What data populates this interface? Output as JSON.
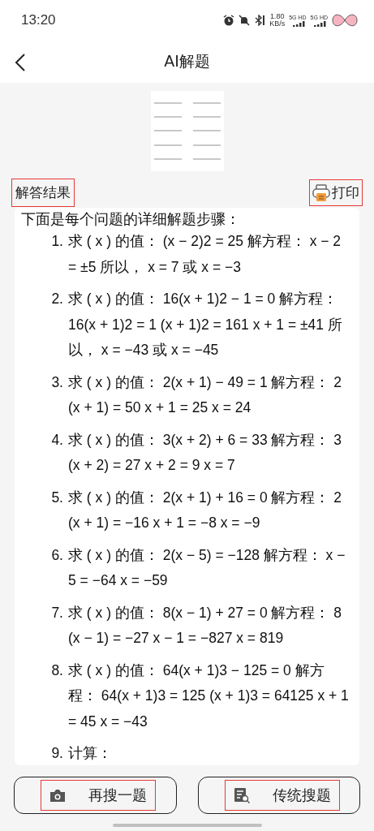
{
  "status_bar": {
    "time": "13:20",
    "speed_value": "1.80",
    "speed_unit": "KB/s",
    "networks": [
      "5G HD",
      "5G HD"
    ]
  },
  "header": {
    "title": "AI解题"
  },
  "result_bar": {
    "label": "解答结果",
    "print_label": "打印"
  },
  "solution": {
    "intro": "下面是每个问题的详细解题步骤：",
    "steps": [
      {
        "number": "1.",
        "text": "求 ( x ) 的值： (x − 2)2 = 25 解方程： x − 2 = ±5 所以， x = 7 或 x = −3"
      },
      {
        "number": "2.",
        "text": "求 ( x ) 的值： 16(x + 1)2 − 1 = 0 解方程： 16(x + 1)2 = 1 (x + 1)2 = 161 x + 1 = ±41 所以， x = −43 或 x = −45"
      },
      {
        "number": "3.",
        "text": "求 ( x ) 的值： 2(x + 1) − 49 = 1 解方程： 2 (x + 1) = 50 x + 1 = 25 x = 24"
      },
      {
        "number": "4.",
        "text": "求 ( x ) 的值： 3(x + 2) + 6 = 33 解方程： 3 (x + 2) = 27 x + 2 = 9 x = 7"
      },
      {
        "number": "5.",
        "text": "求 ( x ) 的值： 2(x + 1) + 16 = 0 解方程： 2 (x + 1) = −16 x + 1 = −8 x = −9"
      },
      {
        "number": "6.",
        "text": "求 ( x ) 的值： 2(x − 5) = −128 解方程： x − 5 = −64 x = −59"
      },
      {
        "number": "7.",
        "text": "求 ( x ) 的值： 8(x − 1) + 27 = 0 解方程： 8 (x − 1) = −27 x − 1 = −827 x = 819"
      },
      {
        "number": "8.",
        "text": "求 ( x ) 的值： 64(x + 1)3 − 125 = 0 解方程： 64(x + 1)3 = 125 (x + 1)3 = 64125 x + 1 = 45 x = −43"
      },
      {
        "number": "9.",
        "text": "计算："
      }
    ]
  },
  "buttons": [
    {
      "kind": "camera",
      "label": "再搜一题"
    },
    {
      "kind": "search-doc",
      "label": "传统搜题"
    }
  ]
}
